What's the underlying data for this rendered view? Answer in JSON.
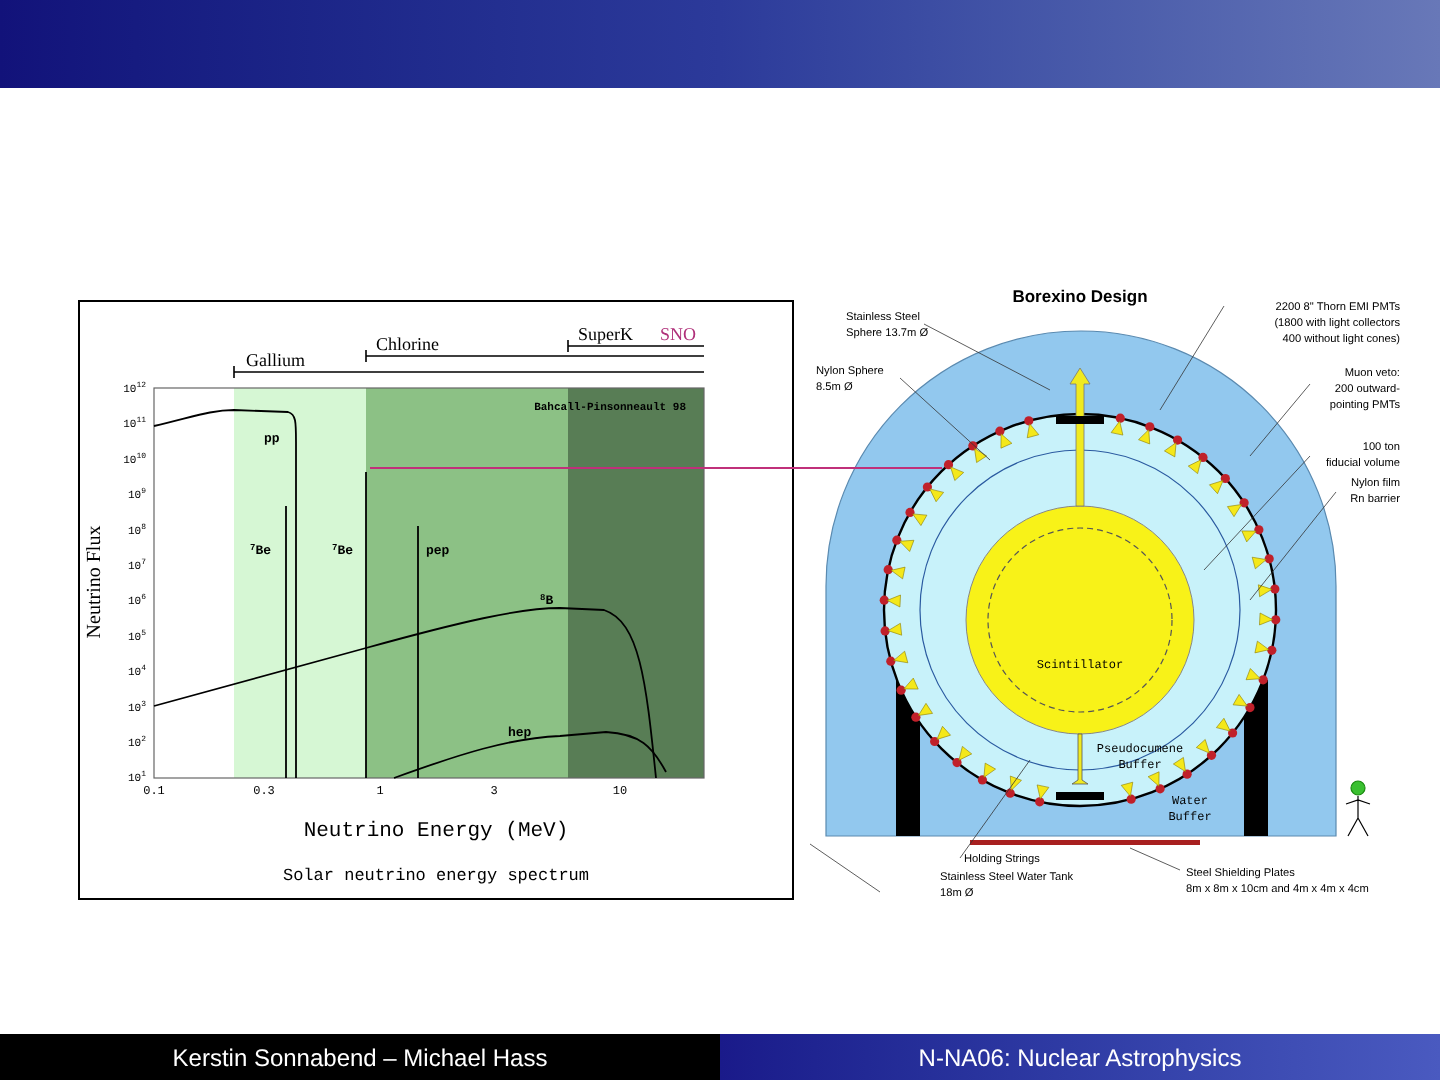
{
  "spectrum": {
    "detectors": [
      {
        "label": "Gallium",
        "color": "#000000"
      },
      {
        "label": "Chlorine",
        "color": "#000000"
      },
      {
        "label": "SuperK",
        "color": "#000000"
      },
      {
        "label": "SNO",
        "color": "#b0307a"
      }
    ],
    "source_note": "Bahcall-Pinsonneault 98",
    "ylabel": "Neutrino Flux",
    "yticks": [
      {
        "base": "10",
        "exponent": "12"
      },
      {
        "base": "10",
        "exponent": "11"
      },
      {
        "base": "10",
        "exponent": "10"
      },
      {
        "base": "10",
        "exponent": "9"
      },
      {
        "base": "10",
        "exponent": "8"
      },
      {
        "base": "10",
        "exponent": "7"
      },
      {
        "base": "10",
        "exponent": "6"
      },
      {
        "base": "10",
        "exponent": "5"
      },
      {
        "base": "10",
        "exponent": "4"
      },
      {
        "base": "10",
        "exponent": "3"
      },
      {
        "base": "10",
        "exponent": "2"
      },
      {
        "base": "10",
        "exponent": "1"
      }
    ],
    "xticks": [
      "0.1",
      "0.3",
      "1",
      "3",
      "10"
    ],
    "sources": [
      {
        "kind": "continuum",
        "label": "pp"
      },
      {
        "kind": "line",
        "mass": "7",
        "label": "Be"
      },
      {
        "kind": "line",
        "mass": "7",
        "label": "Be"
      },
      {
        "kind": "line",
        "label": "pep"
      },
      {
        "kind": "continuum",
        "mass": "8",
        "label": "B"
      },
      {
        "kind": "continuum",
        "label": "hep"
      }
    ],
    "xlabel": "Neutrino Energy (MeV)",
    "caption": "Solar neutrino energy spectrum"
  },
  "design": {
    "title": "Borexino Design",
    "labels": [
      {
        "lines": [
          "Stainless Steel",
          "Sphere 13.7m Ø"
        ]
      },
      {
        "lines": [
          "Nylon Sphere",
          "8.5m Ø"
        ]
      },
      {
        "lines": [
          "2200 8\" Thorn EMI PMTs",
          "(1800 with light collectors",
          "400 without light cones)"
        ]
      },
      {
        "lines": [
          "Muon veto:",
          "200 outward-",
          "pointing PMTs"
        ]
      },
      {
        "lines": [
          "100 ton",
          "fiducial volume"
        ]
      },
      {
        "lines": [
          "Nylon film",
          "Rn barrier"
        ]
      },
      {
        "lines": [
          "Scintillator"
        ]
      },
      {
        "lines": [
          "Pseudocumene",
          "Buffer"
        ]
      },
      {
        "lines": [
          "Water",
          "Buffer"
        ]
      },
      {
        "lines": [
          "Holding Strings"
        ]
      },
      {
        "lines": [
          "Stainless Steel Water Tank",
          "18m Ø"
        ]
      },
      {
        "lines": [
          "Steel Shielding Plates",
          "8m x 8m x 10cm and 4m x 4m x 4cm"
        ]
      }
    ]
  },
  "footer": {
    "authors": "Kerstin Sonnabend – Michael Hass",
    "course": "N-NA06: Nuclear Astrophysics"
  }
}
